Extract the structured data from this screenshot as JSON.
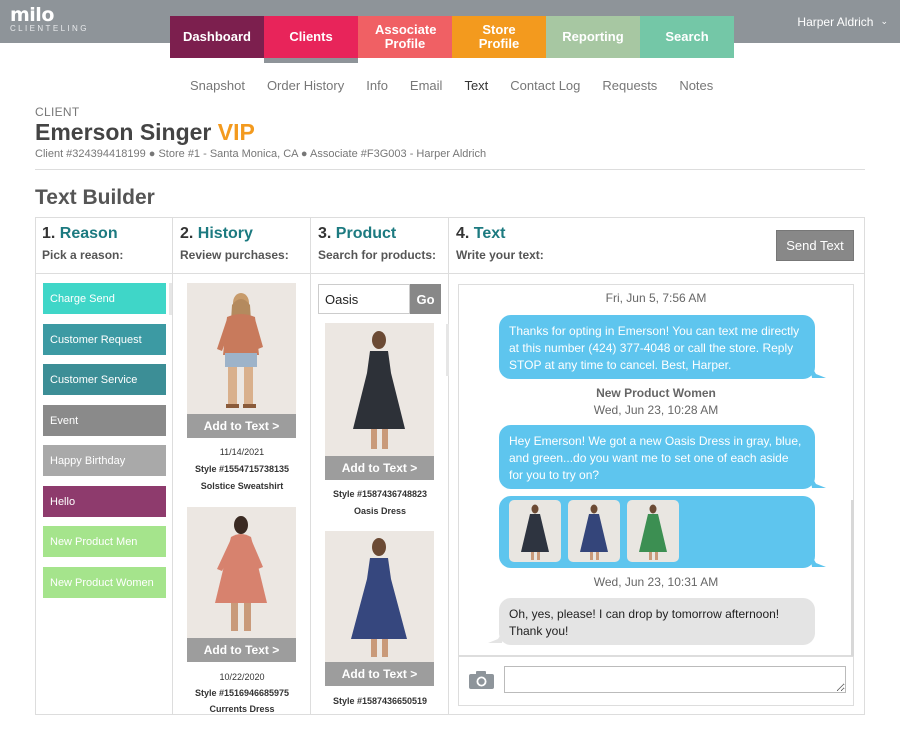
{
  "app": {
    "logo": "milo",
    "logo_sub": "CLIENTELING",
    "user_name": "Harper Aldrich"
  },
  "main_tabs": [
    {
      "label": "Dashboard",
      "color": "#7c1f4e"
    },
    {
      "label": "Clients",
      "color": "#e8245a"
    },
    {
      "label": "Associate Profile",
      "color": "#f06064"
    },
    {
      "label": "Store Profile",
      "color": "#f39a1e"
    },
    {
      "label": "Reporting",
      "color": "#a7c7a2"
    },
    {
      "label": "Search",
      "color": "#74c7a7"
    }
  ],
  "sub_tabs": [
    "Snapshot",
    "Order History",
    "Info",
    "Email",
    "Text",
    "Contact Log",
    "Requests",
    "Notes"
  ],
  "client": {
    "label": "CLIENT",
    "name": "Emerson Singer",
    "badge": "VIP",
    "meta": "Client #324394418199 ● Store #1 - Santa Monica, CA ● Associate #F3G003 - Harper Aldrich"
  },
  "builder": {
    "title": "Text Builder",
    "cols": [
      {
        "num": "1.",
        "title": "Reason",
        "sub": "Pick a reason:"
      },
      {
        "num": "2.",
        "title": "History",
        "sub": "Review purchases:"
      },
      {
        "num": "3.",
        "title": "Product",
        "sub": "Search for products:"
      },
      {
        "num": "4.",
        "title": "Text",
        "sub": "Write your text:"
      }
    ],
    "send_label": "Send Text"
  },
  "reasons": [
    {
      "label": "Charge Send",
      "color": "#3fd6c8"
    },
    {
      "label": "Customer Request",
      "color": "#3c9aa3"
    },
    {
      "label": "Customer Service",
      "color": "#3c8e96"
    },
    {
      "label": "Event",
      "color": "#8a8a8a"
    },
    {
      "label": "Happy Birthday",
      "color": "#a9a9a9"
    },
    {
      "label": "Hello",
      "color": "#8e3b6d"
    },
    {
      "label": "New Product Men",
      "color": "#a5e48c"
    },
    {
      "label": "New Product Women",
      "color": "#a5e48c"
    }
  ],
  "history": [
    {
      "add_label": "Add to Text >",
      "date": "11/14/2021",
      "style": "Style #1554715738135",
      "name": "Solstice Sweatshirt"
    },
    {
      "add_label": "Add to Text >",
      "date": "10/22/2020",
      "style": "Style #1516946685975",
      "name": "Currents Dress"
    }
  ],
  "product_search": {
    "value": "Oasis",
    "go_label": "Go"
  },
  "products": [
    {
      "add_label": "Add to Text >",
      "style": "Style #1587436748823",
      "name": "Oasis Dress"
    },
    {
      "add_label": "Add to Text >",
      "style": "Style #1587436650519"
    }
  ],
  "chat": {
    "stamp1": "Fri, Jun 5, 7:56 AM",
    "msg1": "Thanks for opting in Emerson! You can text me directly at this number (424) 377-4048 or call the store. Reply STOP at any time to cancel. Best, Harper.",
    "stamp2_title": "New Product Women",
    "stamp2": "Wed, Jun 23, 10:28 AM",
    "msg2": "Hey Emerson! We got a new Oasis Dress in gray, blue, and green...do you want me to set one of each aside for you to try on?",
    "stamp3": "Wed, Jun 23, 10:31 AM",
    "msg3": "Oh, yes, please! I can drop by tomorrow afternoon! Thank you!",
    "thumb_colors": [
      "#2e3440",
      "#34457a",
      "#3c8f52"
    ]
  },
  "compose": {
    "value": ""
  }
}
